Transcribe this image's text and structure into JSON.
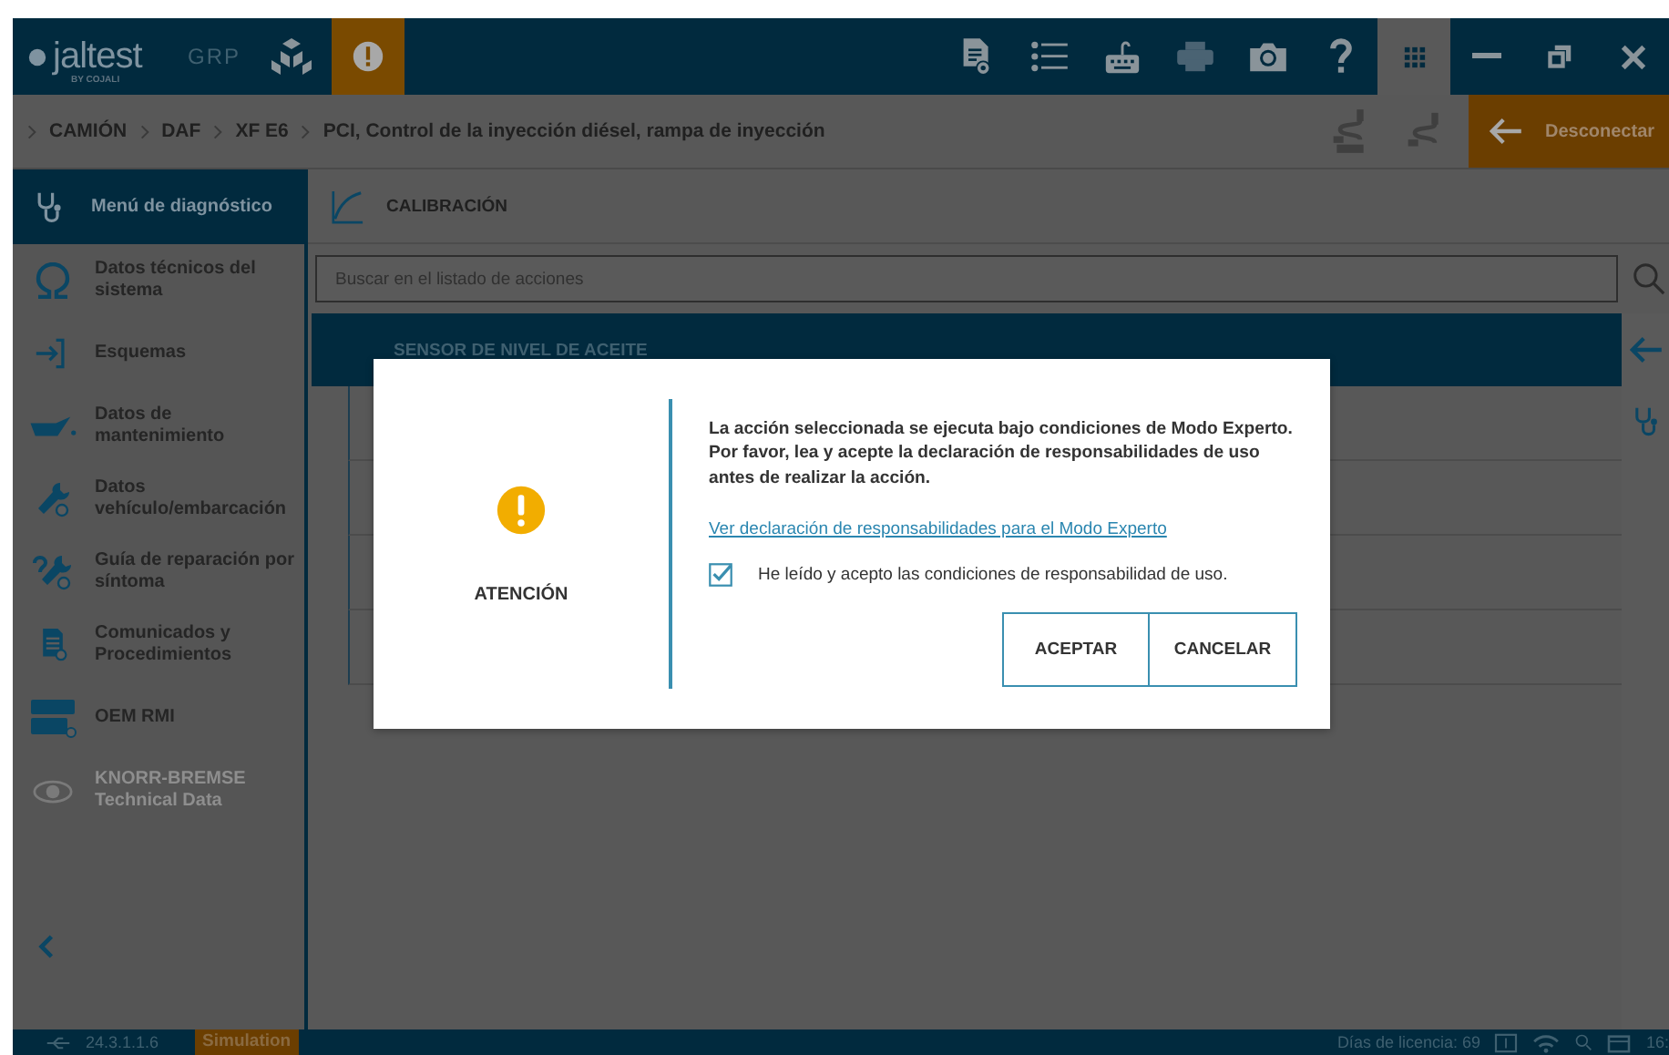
{
  "topbar": {
    "logo": "jaltest",
    "logo_sub": "BY COJALI",
    "edition": "GRP"
  },
  "breadcrumb": [
    "CAMIÓN",
    "DAF",
    "XF E6",
    "PCI, Control de la inyección diésel, rampa de inyección"
  ],
  "disconnect_button": "Desconectar",
  "sidebar": {
    "header": "Menú de diagnóstico",
    "items": [
      {
        "label": "Datos técnicos del sistema",
        "kind": "omega",
        "disabled": false
      },
      {
        "label": "Esquemas",
        "kind": "schema",
        "disabled": false
      },
      {
        "label": "Datos de mantenimiento",
        "kind": "oilcan",
        "disabled": false
      },
      {
        "label": "Datos vehículo/embarcación",
        "kind": "wrench",
        "disabled": false
      },
      {
        "label": "Guía de reparación por síntoma",
        "kind": "question-wrench",
        "disabled": false
      },
      {
        "label": "Comunicados y Procedimientos",
        "kind": "document",
        "disabled": false
      },
      {
        "label": "OEM RMI",
        "kind": "oem",
        "disabled": false
      },
      {
        "label": "KNORR-BREMSE Technical Data",
        "kind": "knorr",
        "disabled": true
      }
    ]
  },
  "section": {
    "title": "CALIBRACIÓN"
  },
  "search": {
    "placeholder": "Buscar en el listado de acciones"
  },
  "actions": [
    {
      "label": "SENSOR DE NIVEL DE ACEITE",
      "selected": true
    }
  ],
  "dialog": {
    "title": "ATENCIÓN",
    "message": "La acción seleccionada se ejecuta bajo condiciones de Modo Experto. Por favor, lea y acepte la declaración de responsabilidades de uso antes de realizar la acción.",
    "link": "Ver declaración de responsabilidades para el Modo Experto",
    "checkbox": {
      "label": "He leído y acepto las condiciones de responsabilidad de uso.",
      "checked": true
    },
    "buttons": [
      "ACEPTAR",
      "CANCELAR"
    ]
  },
  "status_bar": {
    "version": "24.3.1.1.6",
    "mode": "Simulation",
    "license": "Días de licencia: 69",
    "clock": "16:"
  }
}
